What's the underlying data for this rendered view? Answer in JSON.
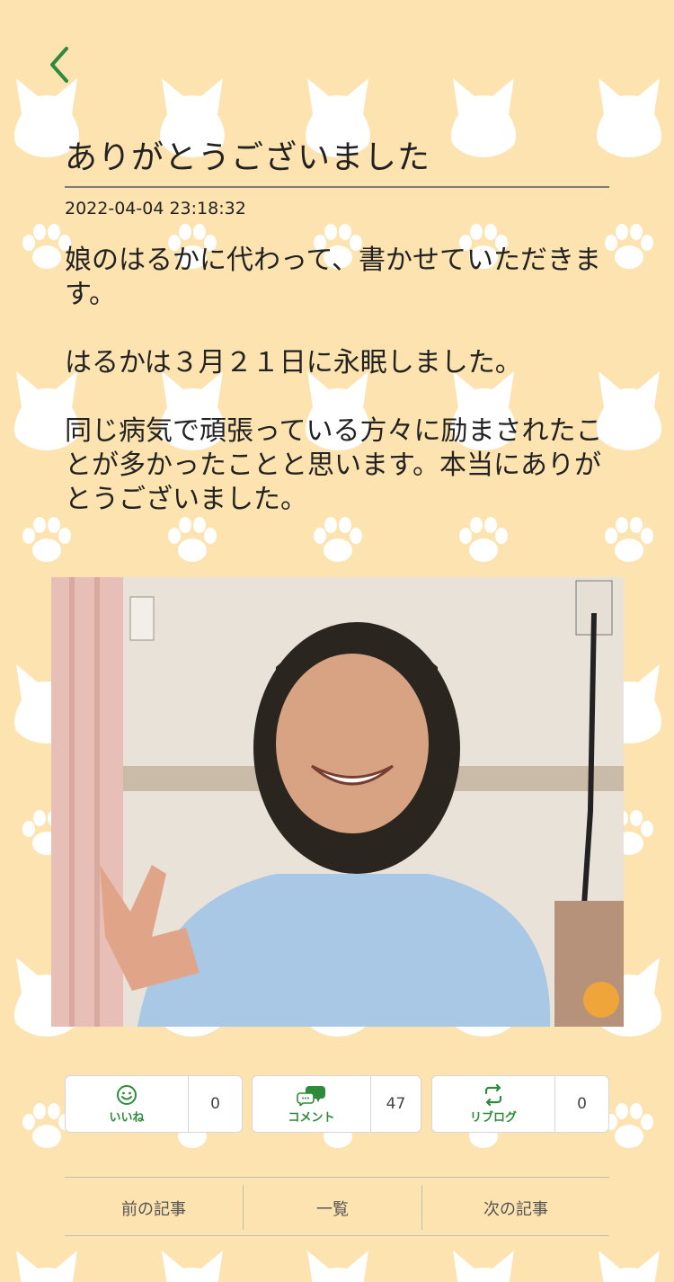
{
  "article": {
    "title": "ありがとうございました",
    "date": "2022-04-04 23:18:32",
    "paragraphs": [
      "娘のはるかに代わって、書かせていただきます。",
      "はるかは３月２１日に永眠しました。",
      "同じ病気で頑張っている方々に励まされたことが多かったことと思います。本当にありがとうございました。"
    ]
  },
  "actions": {
    "like": {
      "label": "いいね",
      "count": "0",
      "icon": "smiley-icon"
    },
    "comment": {
      "label": "コメント",
      "count": "47",
      "icon": "speech-bubble-icon"
    },
    "reblog": {
      "label": "リブログ",
      "count": "0",
      "icon": "reblog-icon"
    }
  },
  "navigation": {
    "prev": "前の記事",
    "list": "一覧",
    "next": "次の記事"
  },
  "colors": {
    "background": "#fde3b0",
    "pattern": "#ffffff",
    "accent": "#2e8b3b"
  }
}
